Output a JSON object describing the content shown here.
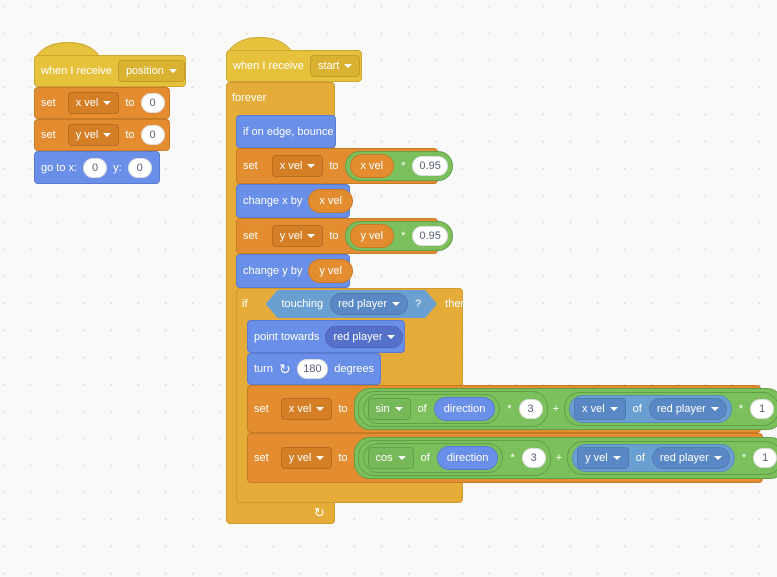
{
  "script1": {
    "hat": {
      "label": "when I receive",
      "message": "position"
    },
    "set1": {
      "label": "set",
      "variable": "x vel",
      "to": "to",
      "value": "0"
    },
    "set2": {
      "label": "set",
      "variable": "y vel",
      "to": "to",
      "value": "0"
    },
    "goto": {
      "label": "go to x:",
      "x": "0",
      "ylabel": "y:",
      "y": "0"
    }
  },
  "script2": {
    "hat": {
      "label": "when I receive",
      "message": "start"
    },
    "forever": {
      "label": "forever"
    },
    "bounce": {
      "label": "if on edge, bounce"
    },
    "setx": {
      "label": "set",
      "variable": "x vel",
      "to": "to",
      "reporter": "x vel",
      "op": "*",
      "value": "0.95"
    },
    "changex": {
      "label": "change x by",
      "reporter": "x vel"
    },
    "sety": {
      "label": "set",
      "variable": "y vel",
      "to": "to",
      "reporter": "y vel",
      "op": "*",
      "value": "0.95"
    },
    "changey": {
      "label": "change y by",
      "reporter": "y vel"
    },
    "if": {
      "label": "if",
      "touching": "touching",
      "target": "red player",
      "q": "?",
      "then": "then",
      "point": {
        "label": "point towards",
        "target": "red player"
      },
      "turn": {
        "label": "turn",
        "value": "180",
        "unit": "degrees"
      },
      "setx2": {
        "label": "set",
        "variable": "x vel",
        "to": "to",
        "func": "sin",
        "of": "of",
        "prop": "direction",
        "mul": "*",
        "factor": "3",
        "plus": "+",
        "attr": "x vel",
        "of2": "of",
        "sprite": "red player",
        "mul2": "*",
        "factor2": "1"
      },
      "sety2": {
        "label": "set",
        "variable": "y vel",
        "to": "to",
        "func": "cos",
        "of": "of",
        "prop": "direction",
        "mul": "*",
        "factor": "3",
        "plus": "+",
        "attr": "y vel",
        "of2": "of",
        "sprite": "red player",
        "mul2": "*",
        "factor2": "1"
      }
    },
    "loop_arrow": "↻"
  }
}
